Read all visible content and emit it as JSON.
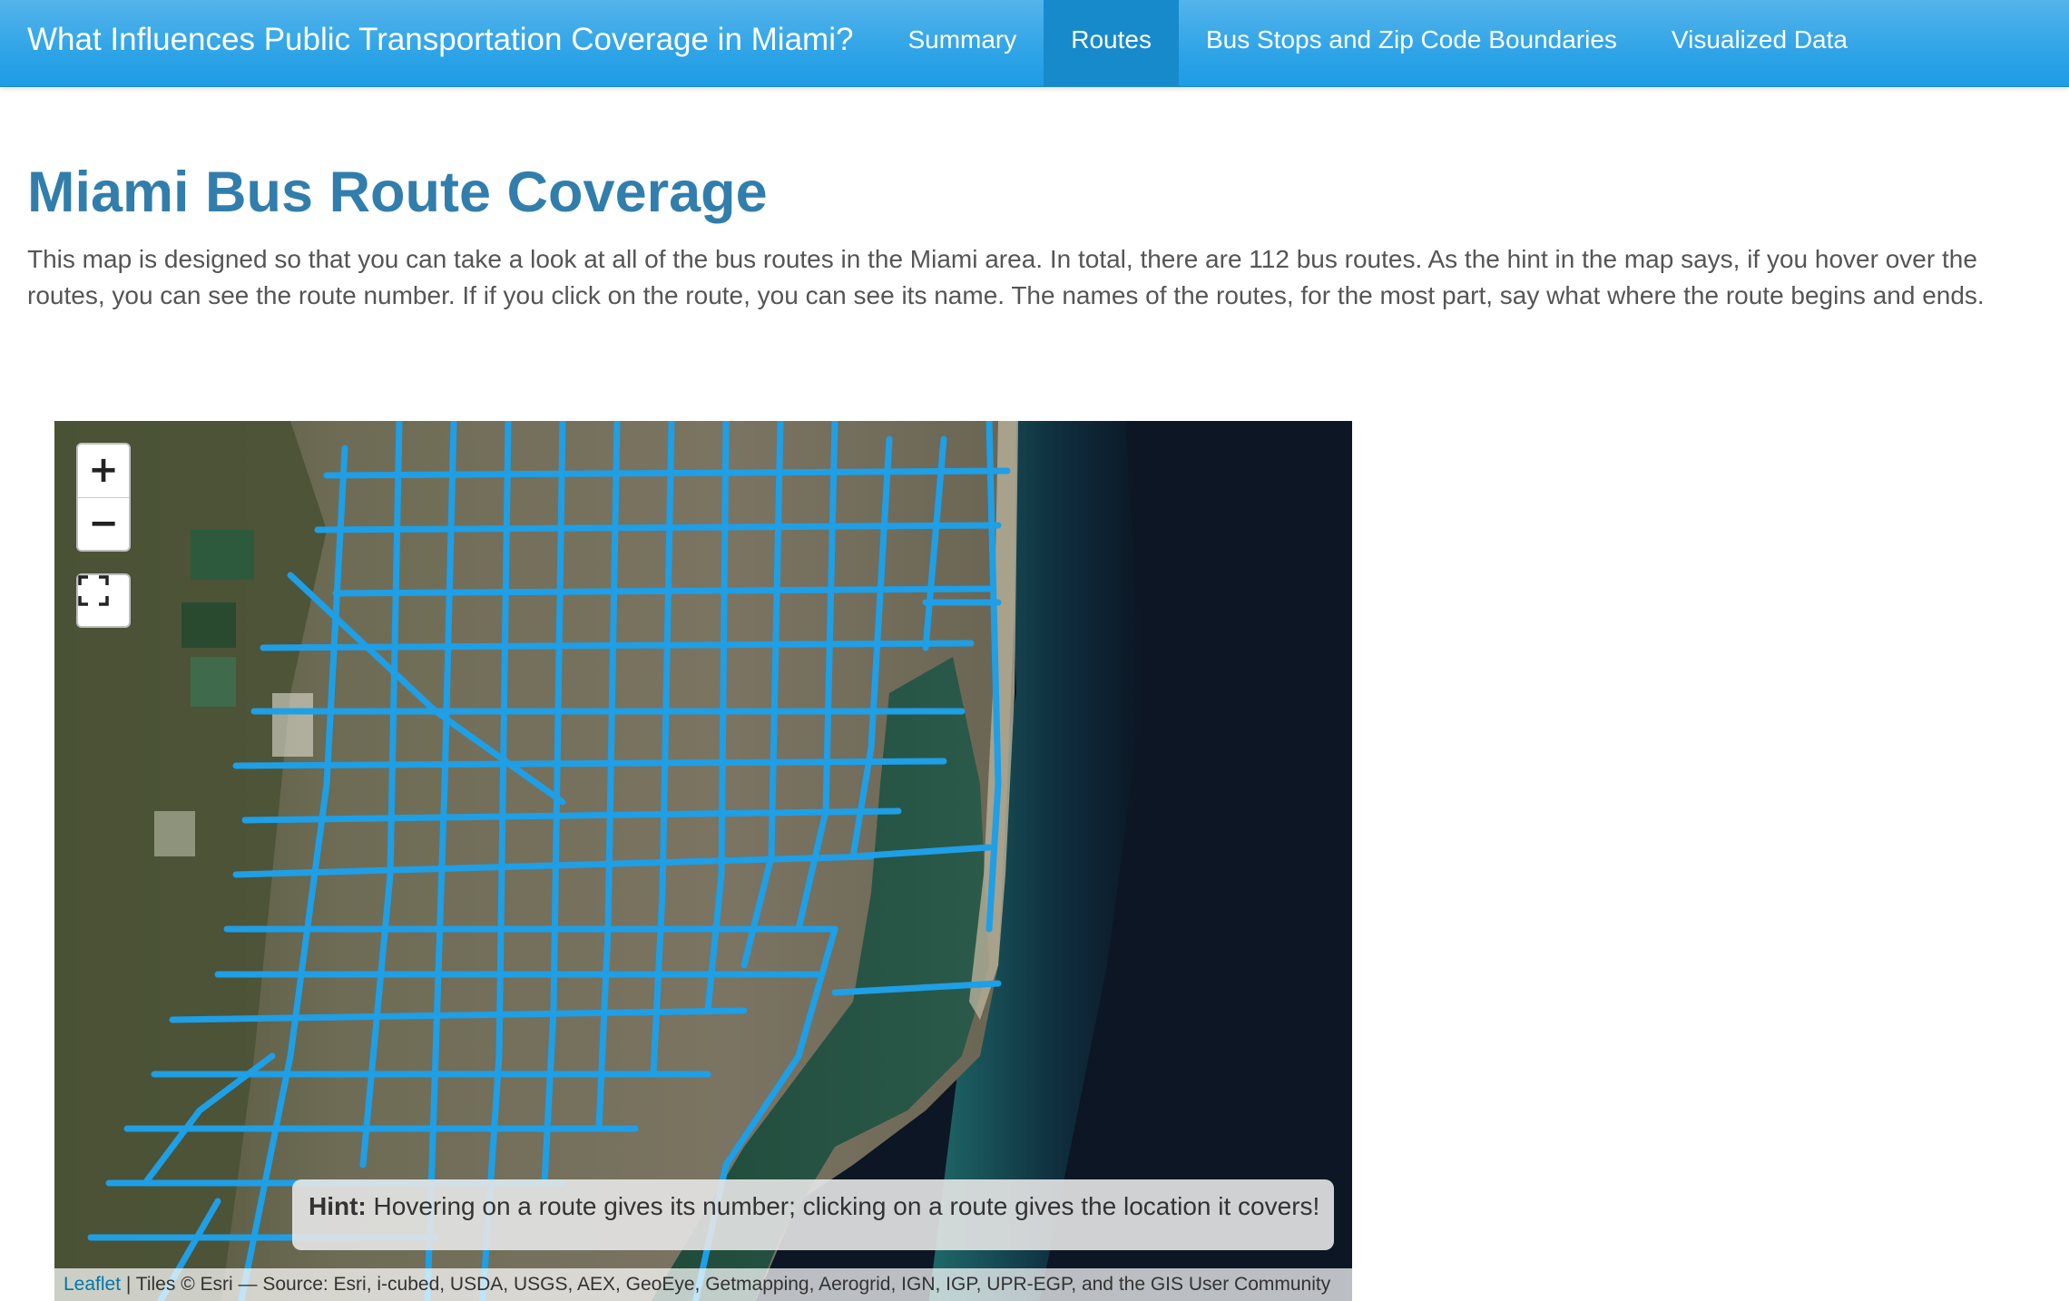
{
  "navbar": {
    "brand": "What Influences Public Transportation Coverage in Miami?",
    "items": [
      {
        "label": "Summary"
      },
      {
        "label": "Routes"
      },
      {
        "label": "Bus Stops and Zip Code Boundaries"
      },
      {
        "label": "Visualized Data"
      }
    ],
    "active_item": "Routes"
  },
  "page": {
    "title": "Miami Bus Route Coverage",
    "intro": "This map is designed so that you can take a look at all of the bus routes in the Miami area. In total, there are 112 bus routes. As the hint in the map says, if you hover over the routes, you can see the route number. If if you click on the route, you can see its name. The names of the routes, for the most part, say what where the route begins and ends."
  },
  "map": {
    "zoom_in": "+",
    "zoom_out": "−",
    "fullscreen_icon": "fullscreen-icon",
    "route_color": "#1e9fe6",
    "hint_label": "Hint:",
    "hint_text": "Hovering on a route gives its number; clicking on a route gives the location it covers!",
    "attribution_link": "Leaflet",
    "attribution_text": " | Tiles © Esri — Source: Esri, i-cubed, USDA, USGS, AEX, GeoEye, Getmapping, Aerogrid, IGN, IGP, UPR-EGP, and the GIS User Community"
  },
  "colors": {
    "navbar": "#2fa4e7",
    "navbar_active": "#178acc",
    "title": "#317eac",
    "land": "#6b6a52",
    "ocean": "#0c1624"
  }
}
